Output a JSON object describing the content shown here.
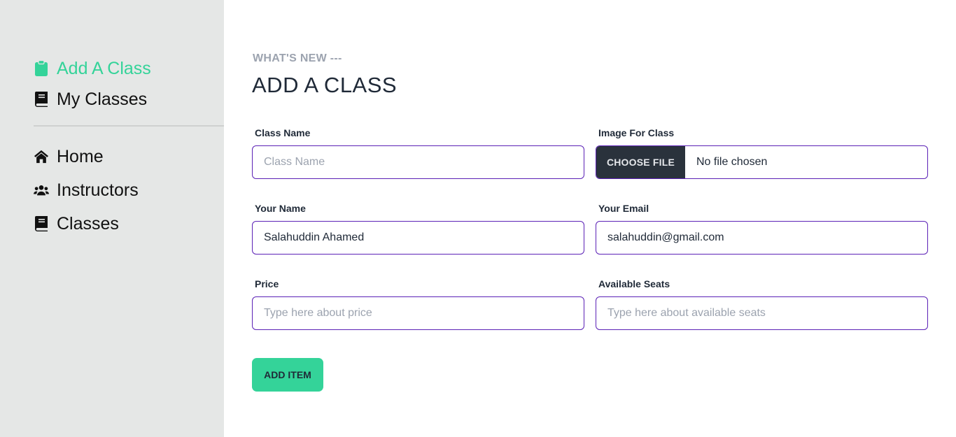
{
  "sidebar": {
    "top_items": [
      {
        "label": "Add A Class",
        "icon": "clipboard-icon",
        "active": true
      },
      {
        "label": "My Classes",
        "icon": "book-icon",
        "active": false
      }
    ],
    "bottom_items": [
      {
        "label": "Home",
        "icon": "home-icon"
      },
      {
        "label": "Instructors",
        "icon": "users-icon"
      },
      {
        "label": "Classes",
        "icon": "book-icon"
      }
    ]
  },
  "header": {
    "eyebrow": "WHAT'S NEW ---",
    "title": "ADD A CLASS"
  },
  "form": {
    "class_name": {
      "label": "Class Name",
      "placeholder": "Class Name",
      "value": ""
    },
    "image": {
      "label": "Image For Class",
      "button_label": "CHOOSE FILE",
      "status": "No file chosen"
    },
    "your_name": {
      "label": "Your Name",
      "placeholder": "",
      "value": "Salahuddin Ahamed"
    },
    "your_email": {
      "label": "Your Email",
      "placeholder": "",
      "value": "salahuddin@gmail.com"
    },
    "price": {
      "label": "Price",
      "placeholder": "Type here about price",
      "value": ""
    },
    "available_seats": {
      "label": "Available Seats",
      "placeholder": "Type here about available seats",
      "value": ""
    },
    "submit_label": "ADD ITEM"
  },
  "colors": {
    "accent": "#34d399",
    "input_border": "#5b21b6",
    "sidebar_bg": "#e5e7e6",
    "file_button_bg": "#2a323c"
  }
}
